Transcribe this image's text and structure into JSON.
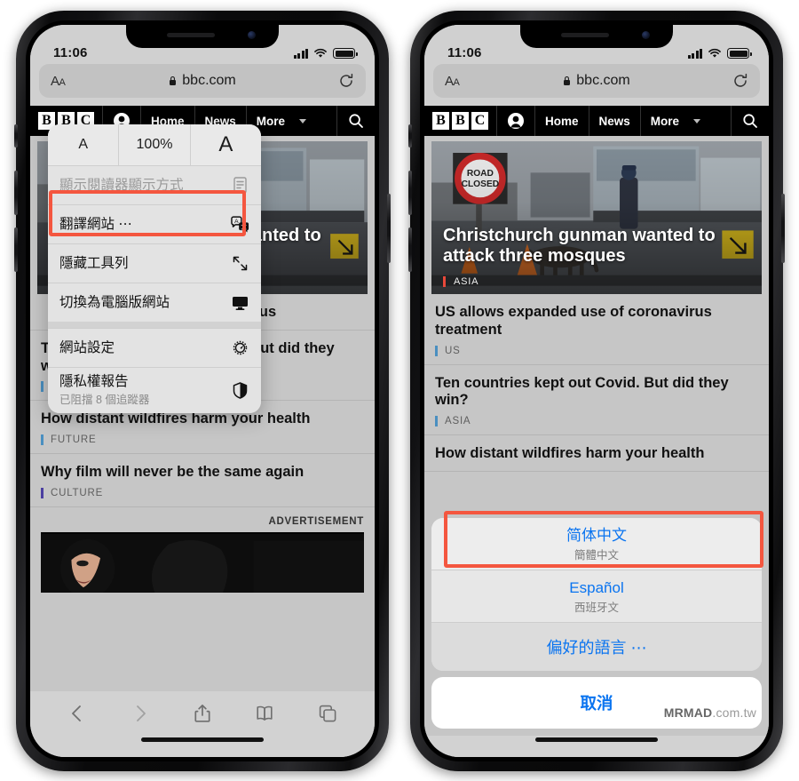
{
  "status_bar": {
    "time": "11:06",
    "signal_icon": "cellular-bars-icon",
    "wifi_icon": "wifi-icon",
    "battery_icon": "battery-icon"
  },
  "browser": {
    "aa_button": "AA",
    "url": "bbc.com",
    "lock_icon": "lock-icon",
    "reload_icon": "reload-icon",
    "toolbar": {
      "back_icon": "back-chevron-icon",
      "forward_icon": "forward-chevron-icon",
      "share_icon": "share-icon",
      "bookmarks_icon": "book-icon",
      "tabs_icon": "tabs-icon"
    }
  },
  "bbc_nav": {
    "logo": [
      "B",
      "B",
      "C"
    ],
    "account_icon": "account-icon",
    "items": [
      "Home",
      "News",
      "More"
    ],
    "caret_icon": "chevron-down-icon",
    "search_icon": "search-icon"
  },
  "hero": {
    "headline": "Christchurch gunman wanted to attack three mosques",
    "category": "ASIA",
    "road_sign_line1": "ROAD",
    "road_sign_line2": "CLOSED"
  },
  "stories": [
    {
      "title": "US allows expanded use of coronavirus treatment",
      "category": "US",
      "accent": "#4a8fc0"
    },
    {
      "title": "Ten countries kept out Covid. But did they win?",
      "category": "ASIA",
      "accent": "#4a8fc0"
    },
    {
      "title": "How distant wildfires harm your health",
      "category": "FUTURE",
      "accent": "#4a8fc0"
    },
    {
      "title": "Why film will never be the same again",
      "category": "CULTURE",
      "accent": "#4b3fa0"
    }
  ],
  "left_story_fragment": "ronavirus",
  "advertisement": {
    "label": "ADVERTISEMENT"
  },
  "aa_menu": {
    "size_smaller": "A",
    "size_percent": "100%",
    "size_larger": "A",
    "items": [
      {
        "label": "顯示閱讀器顯示方式",
        "icon": "reader-view-icon",
        "disabled": true
      },
      {
        "label": "翻譯網站 ⋯",
        "icon": "translate-icon",
        "disabled": false
      },
      {
        "label": "隱藏工具列",
        "icon": "hide-toolbar-icon",
        "disabled": false
      },
      {
        "label": "切換為電腦版網站",
        "icon": "desktop-monitor-icon",
        "disabled": false
      },
      {
        "label": "網站設定",
        "icon": "gear-icon",
        "disabled": false
      },
      {
        "label": "隱私權報告",
        "sub": "已阻擋 8 個追蹤器",
        "icon": "shield-icon",
        "disabled": false
      }
    ]
  },
  "language_sheet": {
    "options": [
      {
        "name": "简体中文",
        "sub": "簡體中文",
        "selected": true
      },
      {
        "name": "Español",
        "sub": "西班牙文",
        "selected": false
      }
    ],
    "preferred": "偏好的語言 ⋯",
    "cancel": "取消"
  },
  "highlight_color": "#f4563f",
  "watermark": {
    "bold": "MRMAD",
    "light": ".com.tw"
  }
}
